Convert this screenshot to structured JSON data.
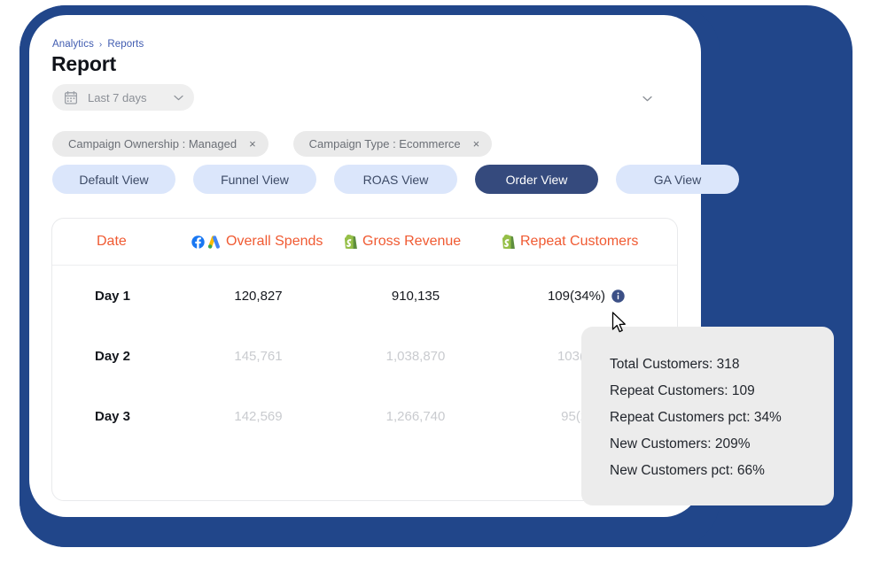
{
  "breadcrumb": {
    "items": [
      "Analytics",
      "Reports"
    ],
    "separator": "›"
  },
  "page": {
    "title": "Report"
  },
  "date_picker": {
    "icon": "calendar-icon",
    "value": "Last 7 days",
    "chevron": "chevron-down-icon"
  },
  "top_right": {
    "chevron": "chevron-down-icon"
  },
  "filter_chips": [
    {
      "label": "Campaign Ownership : Managed",
      "remove": "×"
    },
    {
      "label": "Campaign Type : Ecommerce",
      "remove": "×"
    }
  ],
  "view_tabs": [
    {
      "label": "Default View",
      "active": false
    },
    {
      "label": "Funnel View",
      "active": false
    },
    {
      "label": "ROAS View",
      "active": false
    },
    {
      "label": "Order View",
      "active": true
    },
    {
      "label": "GA View",
      "active": false
    }
  ],
  "table": {
    "columns": [
      {
        "label": "Date",
        "icons": []
      },
      {
        "label": "Overall Spends",
        "icons": [
          "facebook-icon",
          "google-ads-icon"
        ]
      },
      {
        "label": "Gross Revenue",
        "icons": [
          "shopify-icon"
        ]
      },
      {
        "label": "Repeat Customers",
        "icons": [
          "shopify-icon"
        ]
      }
    ],
    "rows": [
      {
        "date": "Day 1",
        "overall_spends": "120,827",
        "gross_revenue": "910,135",
        "repeat_customers": "109(34%)",
        "has_info_icon": true,
        "dim": false
      },
      {
        "date": "Day 2",
        "overall_spends": "145,761",
        "gross_revenue": "1,038,870",
        "repeat_customers": "103(32%)",
        "has_info_icon": false,
        "dim": true
      },
      {
        "date": "Day 3",
        "overall_spends": "142,569",
        "gross_revenue": "1,266,740",
        "repeat_customers": "95(27%)",
        "has_info_icon": false,
        "dim": true
      }
    ]
  },
  "tooltip": {
    "lines": [
      "Total Customers: 318",
      "Repeat Customers: 109",
      "Repeat Customers pct: 34%",
      "New Customers: 209%",
      "New Customers pct: 66%"
    ]
  },
  "colors": {
    "frame_navy": "#21468a",
    "accent_orange": "#f05a32",
    "active_tab": "#354a7d",
    "tab_bg": "#dbe6fb",
    "chip_bg": "#eaeaea",
    "tooltip_bg": "#ececec",
    "breadcrumb_blue": "#3f5bb0"
  }
}
